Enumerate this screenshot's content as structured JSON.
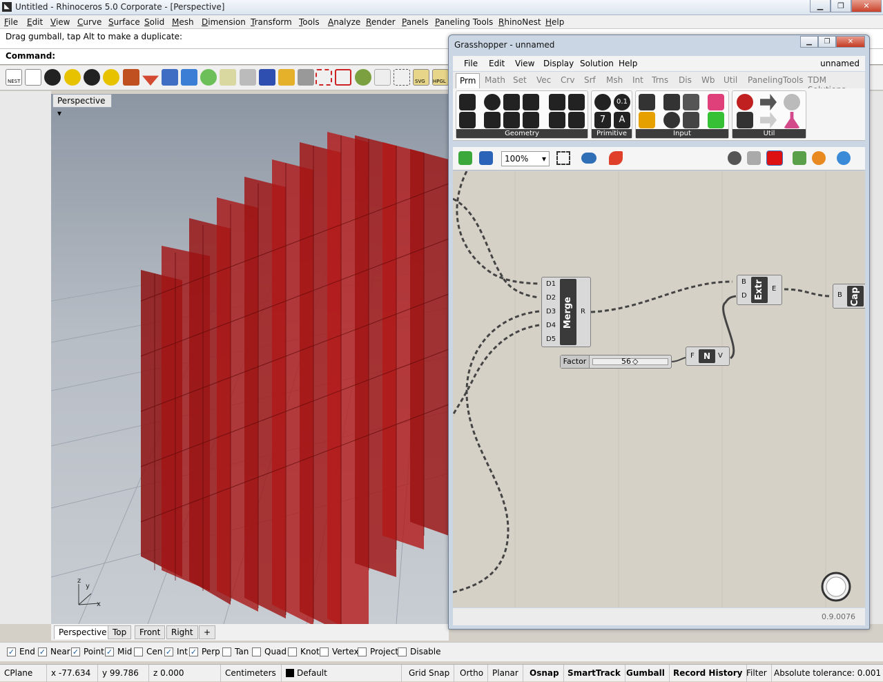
{
  "window": {
    "title": "Untitled - Rhinoceros  5.0 Corporate - [Perspective]"
  },
  "menu": [
    "File",
    "Edit",
    "View",
    "Curve",
    "Surface",
    "Solid",
    "Mesh",
    "Dimension",
    "Transform",
    "Tools",
    "Analyze",
    "Render",
    "Panels",
    "Paneling Tools",
    "RhinoNest",
    "Help"
  ],
  "command": {
    "history": "Drag gumball, tap Alt to make a duplicate:",
    "prompt": "Command:"
  },
  "toolbar": {
    "nest_label": "NEST",
    "svg_label": "SVG",
    "hpgl_label": "HPGL"
  },
  "viewport": {
    "name": "Perspective",
    "axis_z": "z",
    "axis_y": "y",
    "axis_x": "x"
  },
  "viewport_tabs": [
    "Perspective",
    "Top",
    "Front",
    "Right"
  ],
  "osnaps": [
    {
      "label": "End",
      "checked": true
    },
    {
      "label": "Near",
      "checked": true
    },
    {
      "label": "Point",
      "checked": true
    },
    {
      "label": "Mid",
      "checked": true
    },
    {
      "label": "Cen",
      "checked": false
    },
    {
      "label": "Int",
      "checked": true
    },
    {
      "label": "Perp",
      "checked": true
    },
    {
      "label": "Tan",
      "checked": false
    },
    {
      "label": "Quad",
      "checked": false
    },
    {
      "label": "Knot",
      "checked": false
    },
    {
      "label": "Vertex",
      "checked": false
    },
    {
      "label": "Project",
      "checked": false
    },
    {
      "label": "Disable",
      "checked": false
    }
  ],
  "status": {
    "cplane": "CPlane",
    "x": "x -77.634",
    "y": "y 99.786",
    "z": "z 0.000",
    "units": "Centimeters",
    "layer": "Default",
    "toggles": [
      "Grid Snap",
      "Ortho",
      "Planar",
      "Osnap",
      "SmartTrack",
      "Gumball",
      "Record History",
      "Filter"
    ],
    "tolerance": "Absolute tolerance: 0.001"
  },
  "grasshopper": {
    "title": "Grasshopper - unnamed",
    "menu": [
      "File",
      "Edit",
      "View",
      "Display",
      "Solution",
      "Help"
    ],
    "doc_name": "unnamed",
    "tabs": [
      "Prm",
      "Math",
      "Set",
      "Vec",
      "Crv",
      "Srf",
      "Msh",
      "Int",
      "Trns",
      "Dis",
      "Wb",
      "Util",
      "PanelingTools",
      "TDM Solutions"
    ],
    "ribbon_groups": [
      "Geometry",
      "Primitive",
      "Input",
      "Util"
    ],
    "primitive_labels": {
      "a": "0.1",
      "b": "7",
      "c": "A"
    },
    "zoom": "100%",
    "version": "0.9.0076",
    "merge": {
      "name": "Merge",
      "inputs": [
        "D1",
        "D2",
        "D3",
        "D4",
        "D5"
      ],
      "output": "R"
    },
    "extr": {
      "name": "Extr",
      "inputs": [
        "B",
        "D"
      ],
      "output": "E"
    },
    "cap": {
      "name": "Cap",
      "input": "B"
    },
    "slider": {
      "name": "Factor",
      "value": "56"
    },
    "vector": {
      "name": "N",
      "input": "F",
      "output": "V"
    }
  }
}
